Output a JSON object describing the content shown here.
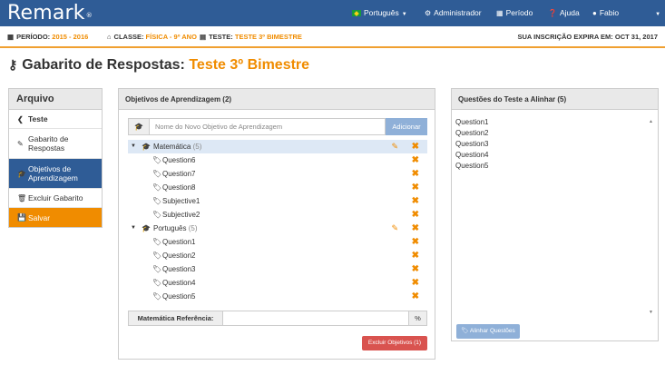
{
  "app": {
    "logo": "Remark",
    "logo_mark": "®"
  },
  "nav": {
    "language": "Português",
    "admin": "Administrador",
    "period": "Período",
    "help": "Ajuda",
    "user": "Fabio"
  },
  "infobar": {
    "period_label": "PERÍODO:",
    "period_value": "2015 - 2016",
    "class_label": "CLASSE:",
    "class_value": "FÍSICA - 9º ANO",
    "test_label": "TESTE:",
    "test_value": "TESTE 3º BIMESTRE",
    "expires": "SUA INSCRIÇÃO EXPIRA EM:  OCT 31, 2017"
  },
  "page": {
    "title": "Gabarito de Respostas:",
    "title_highlight": "Teste 3º Bimestre"
  },
  "sidebar": {
    "header": "Arquivo",
    "items": [
      {
        "label": "Teste"
      },
      {
        "label": "Gabarito de Respostas"
      },
      {
        "label": "Objetivos de Aprendizagem"
      },
      {
        "label": "Excluir Gabarito"
      },
      {
        "label": "Salvar"
      }
    ]
  },
  "objectives": {
    "header": "Objetivos de Aprendizagem (2)",
    "input_placeholder": "Nome do Novo Objetivo de Aprendizagem",
    "add_button": "Adicionar",
    "groups": [
      {
        "name": "Matemática",
        "count": "(5)",
        "items": [
          "Question6",
          "Question7",
          "Question8",
          "Subjective1",
          "Subjective2"
        ]
      },
      {
        "name": "Português",
        "count": "(5)",
        "items": [
          "Question1",
          "Question2",
          "Question3",
          "Question4",
          "Question5"
        ]
      }
    ],
    "ref_label": "Matemática Referência:",
    "ref_unit": "%",
    "delete_button": "Excluir Objetivos (1)"
  },
  "questions": {
    "header": "Questões do Teste a Alinhar (5)",
    "items": [
      "Question1",
      "Question2",
      "Question3",
      "Question4",
      "Question5"
    ],
    "align_button": "Alinhar Questões"
  },
  "colors": {
    "brand": "#2f5c96",
    "accent": "#f08c00",
    "danger": "#d9534f"
  }
}
